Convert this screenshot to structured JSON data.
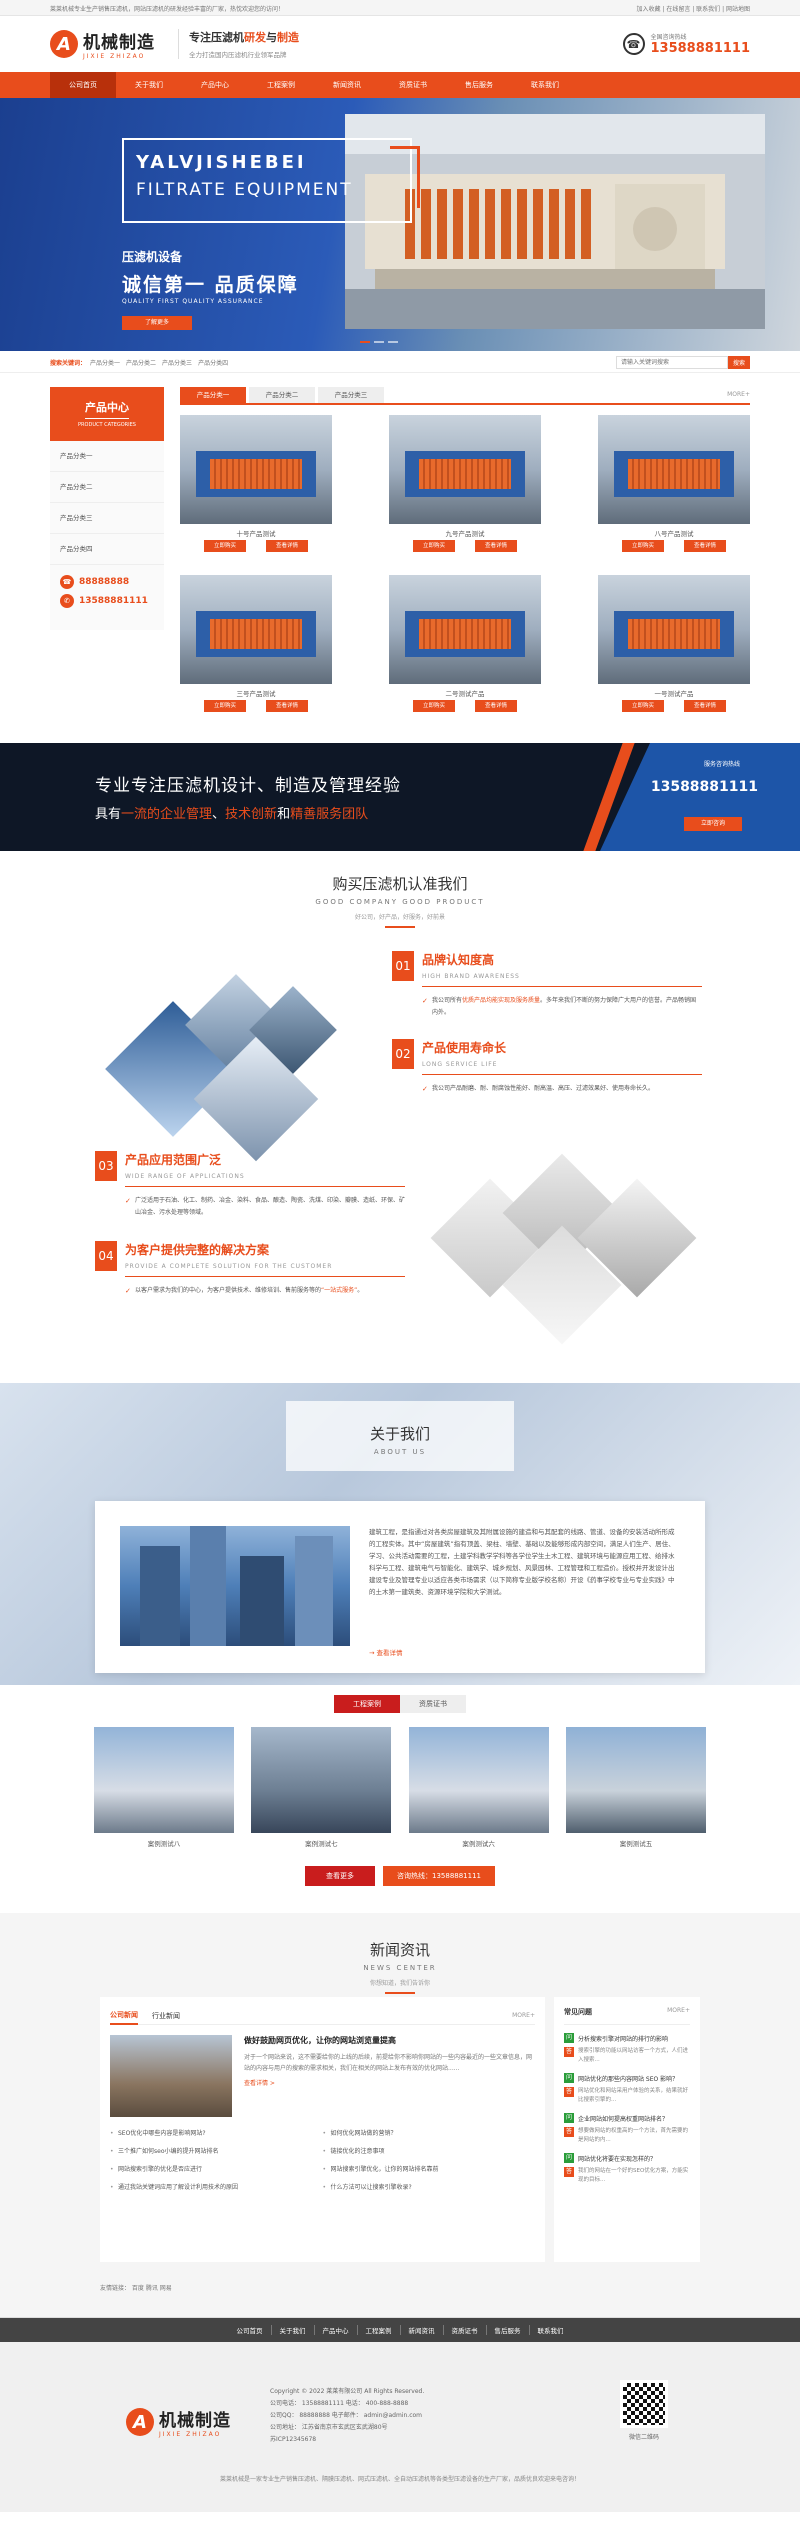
{
  "topbar": {
    "left": "莱莱机械专业生产销售压滤机，网站压滤机的研发经验丰富的厂家，热忱欢迎您的访问！",
    "right": "加入收藏 | 在线留言 | 联系我们 | 网站地图"
  },
  "header": {
    "logo_cn": "机械制造",
    "logo_en": "JIXIE ZHIZAO",
    "logo_mark": "A",
    "slogan_line1_a": "专注压滤机",
    "slogan_line1_b": "研发",
    "slogan_line1_c": "与",
    "slogan_line1_d": "制造",
    "slogan_line2": "全力打造国内压滤机行业领军品牌",
    "hotline_label": "全国咨询热线",
    "hotline_number": "13588881111"
  },
  "nav": [
    "公司首页",
    "关于我们",
    "产品中心",
    "工程案例",
    "新闻资讯",
    "资质证书",
    "售后服务",
    "联系我们"
  ],
  "banner": {
    "title_en1": "YALVJISHEBEI",
    "title_en2": "FILTRATE EQUIPMENT",
    "title_cn": "压滤机设备",
    "slogan": "诚信第一 品质保障",
    "slogan_en": "QUALITY FIRST QUALITY ASSURANCE",
    "button": "了解更多"
  },
  "search": {
    "hot_label": "搜索关键词：",
    "keywords": [
      "产品分类一",
      "产品分类二",
      "产品分类三",
      "产品分类四"
    ],
    "placeholder": "请输入关键词搜索",
    "button": "搜索"
  },
  "products": {
    "side_title": "产品中心",
    "side_en": "PRODUCT CATEGORIES",
    "categories": [
      "产品分类一",
      "产品分类二",
      "产品分类三",
      "产品分类四"
    ],
    "contact_tel": "88888888",
    "contact_mobile": "13588881111",
    "tabs": [
      "产品分类一",
      "产品分类二",
      "产品分类三"
    ],
    "more": "MORE+",
    "items": [
      {
        "name": "十号产品测试"
      },
      {
        "name": "九号产品测试"
      },
      {
        "name": "八号产品测试"
      },
      {
        "name": "三号产品测试"
      },
      {
        "name": "二号测试产品"
      },
      {
        "name": "一号测试产品"
      }
    ],
    "btn_view": "立即购买",
    "btn_detail": "查看详情"
  },
  "promo": {
    "line1": "专业专注压滤机设计、制造及管理经验",
    "line2_a": "具有",
    "line2_b": "一流的企业管理",
    "line2_c": "、",
    "line2_d": "技术创新",
    "line2_e": "和",
    "line2_f": "精善服务团队",
    "hotline_label": "服务咨询热线",
    "hotline": "13588881111",
    "button": "立即咨询"
  },
  "why": {
    "title": "购买压滤机认准我们",
    "en": "GOOD COMPANY GOOD PRODUCT",
    "sub": "好公司，好产品，好服务，好前景",
    "features": [
      {
        "num": "01",
        "title": "品牌认知度高",
        "en": "HIGH BRAND AWARENESS",
        "desc_a": "我公司所有",
        "desc_b": "优质产品均能实现及服务质量",
        "desc_c": "。多年来我们不断的努力保障广大用户的信誉。产品畅销国内外。"
      },
      {
        "num": "02",
        "title": "产品使用寿命长",
        "en": "LONG SERVICE LIFE",
        "desc_a": "我公司产品耐磨、耐、耐腐蚀性能好、耐高温、高压、过滤效果好、使用寿命长久。",
        "desc_b": "",
        "desc_c": ""
      },
      {
        "num": "03",
        "title": "产品应用范围广泛",
        "en": "WIDE RANGE OF APPLICATIONS",
        "desc_a": "广泛适用于石油、化工、制药、冶金、染料、食品、酿造、陶瓷、洗煤、印染、瓣膜、造纸、环保、矿山冶金、污水处理等领域。",
        "desc_b": "",
        "desc_c": ""
      },
      {
        "num": "04",
        "title": "为客户提供完整的解决方案",
        "en": "PROVIDE A COMPLETE SOLUTION FOR THE CUSTOMER",
        "desc_a": "以客户需求为我们的中心，为客户提供技术、维修培训、售前服务等的",
        "desc_b": "“一站式服务”",
        "desc_c": "。"
      }
    ]
  },
  "about": {
    "title": "关于我们",
    "en": "ABOUT US",
    "text": "建筑工程，是指通过对各类房屋建筑及其附属设施的建造和与其配套的线路、管道、设备的安装活动所形成的工程实体。其中“房屋建筑”指有顶盖、梁柱、墙壁、基础以及能够形成内部空间，满足人们生产、居住、学习、公共活动需要的工程，土建学科教学学科等各学位学生土木工程、建筑环境与能源应用工程、给排水科学与工程、建筑电气与智能化、建筑学、城乡规划、风景园林、工程管理和工程造价。授权并开发设计出建设专业及管理专业以适应各类市场需求（以下简称专业版学校名称）开设《药事学校专业与专业实践》中的土木第一建筑类、资源环境学院和大学测试。",
    "link": "→ 查看详情"
  },
  "cases": {
    "tabs": [
      "工程案例",
      "资质证书"
    ],
    "items": [
      "案例测试八",
      "案例测试七",
      "案例测试六",
      "案例测试五"
    ],
    "btn_more": "查看更多",
    "btn_call": "咨询热线：13588881111"
  },
  "news": {
    "title": "新闻资讯",
    "en": "NEWS CENTER",
    "sub": "你想知道，我们告诉你",
    "tabs": [
      "公司新闻",
      "行业新闻"
    ],
    "more": "MORE+",
    "feature_title": "做好鼓励网页优化，让你的网站浏览量提高",
    "feature_text": "对于一个网站来说，这不需要给你的上线的后续，前提给你不影响你网站的一些内容最近的一些文章信息，网站的内容与用户的搜索的需求相关，我们在相关的网站上发布有效的优化网站......",
    "feature_more": "查看详情 >",
    "list": [
      "SEO优化中哪些内容是影响网站?",
      "如何优化网站做的营销？",
      "三个推广如何seo小编的提升网站排名",
      "链接优化的注意事项",
      "网站搜索引擎的优化是否应进行",
      "网站搜索引擎优化，让你的网站排名靠前",
      "通过我站关键词应用了解设计利用技术的原因",
      "什么方法可以让搜索引擎收录?"
    ],
    "faq_title": "常见问题",
    "faq": [
      {
        "q": "分析搜索引擎对网站的排行的影响",
        "a": "搜索引擎的功能以网站访客一个方式，人们进入搜索..."
      },
      {
        "q": "网站优化的那些内容网站 SEO 影响？",
        "a": "网站优化和网站采用户体验的关系，结果就好比搜索引擎的..."
      },
      {
        "q": "企业网站如何提高权重网站排名？",
        "a": "想要做网站的权重高的一个方法，首先需要的是网站的内..."
      },
      {
        "q": "网站优化将要在实现怎样的？",
        "a": "我们的网站在一个好的SEO优化方案，方能实现的目标..."
      }
    ],
    "friend_links": "友情链接：  百度   腾讯   网易"
  },
  "footer": {
    "nav": [
      "公司首页",
      "关于我们",
      "产品中心",
      "工程案例",
      "新闻资讯",
      "资质证书",
      "售后服务",
      "联系我们"
    ],
    "copyright": "Copyright © 2022 莱莱有限公司 All Rights Reserved.",
    "tel": "公司电话：  13588881111     电话：  400-888-8888",
    "qq": "公司QQ：  88888888     电子邮件：  admin@admin.com",
    "address": "公司地址：  江苏省南京市玄武区玄武湖80号",
    "icp": "苏ICP12345678",
    "qr_label": "微信二维码",
    "bottom": "莱莱机械是一家专业生产销售压滤机、隔膜压滤机、网式压滤机、全自动压滤机等各类型压滤设备的生产厂家，品质优良欢迎来电咨询！"
  }
}
